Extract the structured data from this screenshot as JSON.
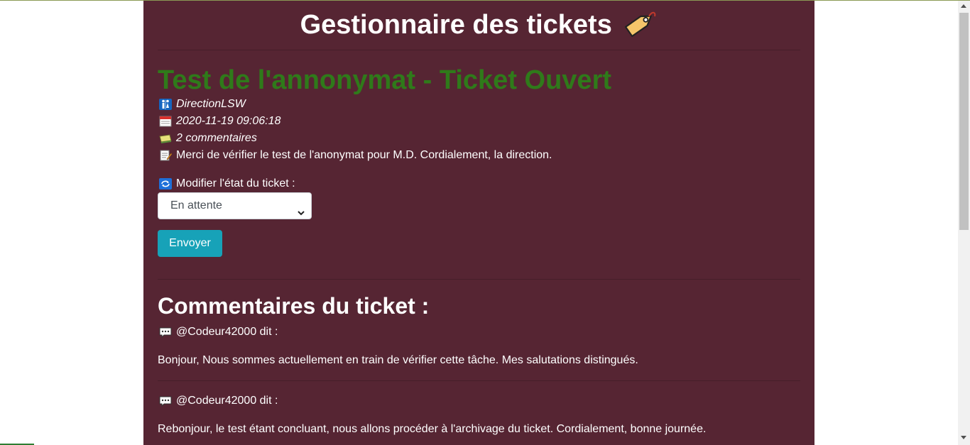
{
  "header": {
    "title": "Gestionnaire des tickets",
    "icon": "label-tag-icon"
  },
  "ticket": {
    "title": "Test de l'annonymat - Ticket Ouvert",
    "title_color": "#2f7a1a",
    "author": "DirectionLSW",
    "date": "2020-11-19 09:06:18",
    "comments_count": "2 commentaires",
    "description": "Merci de vérifier le test de l'anonymat pour M.D. Cordialement, la direction."
  },
  "form": {
    "label": "Modifier l'état du ticket :",
    "selected_state": "En attente",
    "submit_label": "Envoyer",
    "submit_color": "#17a2b8"
  },
  "comments": {
    "title": "Commentaires du ticket :",
    "items": [
      {
        "author_line": "@Codeur42000 dit :",
        "text": "Bonjour, Nous sommes actuellement en train de vérifier cette tâche. Mes salutations distingués."
      },
      {
        "author_line": "@Codeur42000 dit :",
        "text": "Rebonjour, le test étant concluant, nous allons procéder à l'archivage du ticket. Cordialement, bonne journée."
      }
    ]
  },
  "colors": {
    "page_background": "#562533",
    "text": "#ffffff"
  }
}
